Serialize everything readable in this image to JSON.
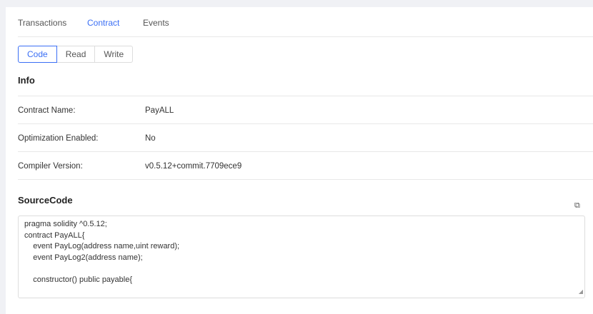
{
  "tabs": [
    "Transactions",
    "Contract",
    "Events"
  ],
  "active_tab": "Contract",
  "code_tabs": [
    "Code",
    "Read",
    "Write"
  ],
  "active_code_tab": "Code",
  "info": {
    "title": "Info",
    "rows": [
      {
        "label": "Contract Name:",
        "value": "PayALL"
      },
      {
        "label": "Optimization Enabled:",
        "value": "No"
      },
      {
        "label": "Compiler Version:",
        "value": "v0.5.12+commit.7709ece9"
      }
    ]
  },
  "source": {
    "title": "SourceCode",
    "code": "pragma solidity ^0.5.12;\ncontract PayALL{\n    event PayLog(address name,uint reward);\n    event PayLog2(address name);\n\n    constructor() public payable{",
    "copy_icon": "copy-icon"
  },
  "colors": {
    "accent": "#3b6ff5",
    "background": "#f0f1f5"
  }
}
